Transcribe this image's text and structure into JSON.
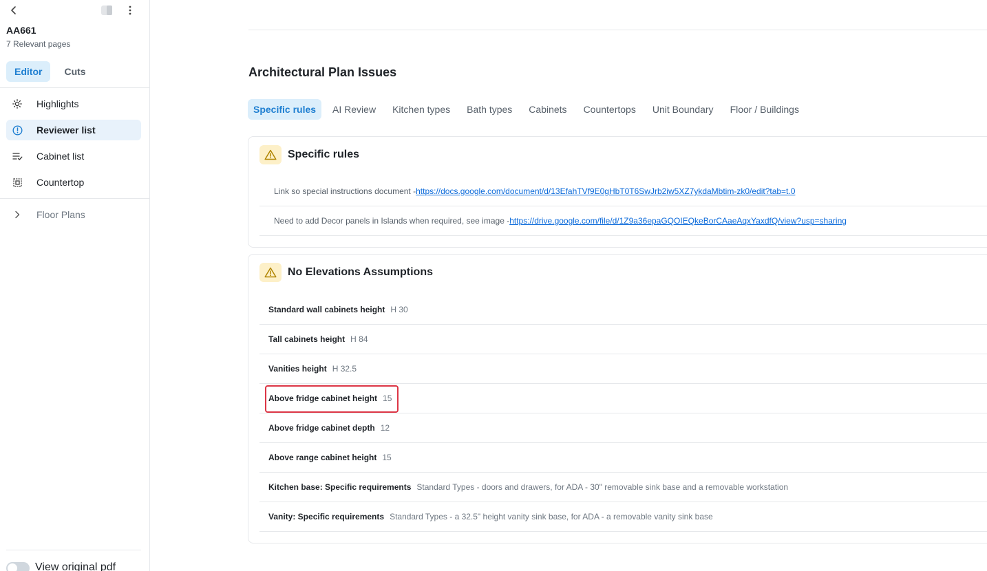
{
  "sidebar": {
    "project_title": "AA661",
    "project_subtitle": "7 Relevant pages",
    "mode_tabs": [
      {
        "label": "Editor",
        "active": true
      },
      {
        "label": "Cuts",
        "active": false
      }
    ],
    "nav": [
      {
        "label": "Highlights",
        "icon": "sun-icon"
      },
      {
        "label": "Reviewer list",
        "icon": "alert-circle-icon",
        "active": true
      },
      {
        "label": "Cabinet list",
        "icon": "list-check-icon"
      },
      {
        "label": "Countertop",
        "icon": "frame-icon"
      },
      {
        "label": "Floor Plans",
        "icon": "chevron-right-icon"
      }
    ],
    "toggle_label": "View original pdf"
  },
  "main": {
    "title": "Architectural Plan Issues",
    "tabs": [
      {
        "label": "Specific rules",
        "active": true
      },
      {
        "label": "AI Review"
      },
      {
        "label": "Kitchen types"
      },
      {
        "label": "Bath types"
      },
      {
        "label": "Cabinets"
      },
      {
        "label": "Countertops"
      },
      {
        "label": "Unit Boundary"
      },
      {
        "label": "Floor / Buildings"
      }
    ],
    "specific_rules": {
      "title": "Specific rules",
      "items": [
        {
          "text": "Link so special instructions document - ",
          "link": "https://docs.google.com/document/d/13EfahTVf9E0gHbT0T6SwJrb2iw5XZ7ykdaMbtim-zk0/edit?tab=t.0"
        },
        {
          "text": "Need to add Decor panels in Islands when required, see image - ",
          "link": "https://drive.google.com/file/d/1Z9a36epaGQOIEQkeBorCAaeAqxYaxdfQ/view?usp=sharing"
        }
      ]
    },
    "assumptions": {
      "title": "No Elevations Assumptions",
      "items": [
        {
          "key": "Standard wall cabinets height",
          "value": "H 30"
        },
        {
          "key": "Tall cabinets height",
          "value": "H 84"
        },
        {
          "key": "Vanities height",
          "value": "H 32.5"
        },
        {
          "key": "Above fridge cabinet height",
          "value": "15"
        },
        {
          "key": "Above fridge cabinet depth",
          "value": "12"
        },
        {
          "key": "Above range cabinet height",
          "value": "15"
        },
        {
          "key": "Kitchen base: Specific requirements",
          "value": "Standard Types - doors and drawers, for ADA - 30\" removable sink base and a removable workstation"
        },
        {
          "key": "Vanity: Specific requirements",
          "value": "Standard Types - a 32.5\" height vanity sink base, for ADA - a removable vanity sink base"
        }
      ]
    }
  },
  "colors": {
    "accent": "#1f7fd1",
    "accent_bg": "#dbeefb",
    "warning_bg": "#fdf0c8",
    "warning_icon": "#b08400",
    "link": "#0969da",
    "highlight_border": "#dc3545"
  }
}
